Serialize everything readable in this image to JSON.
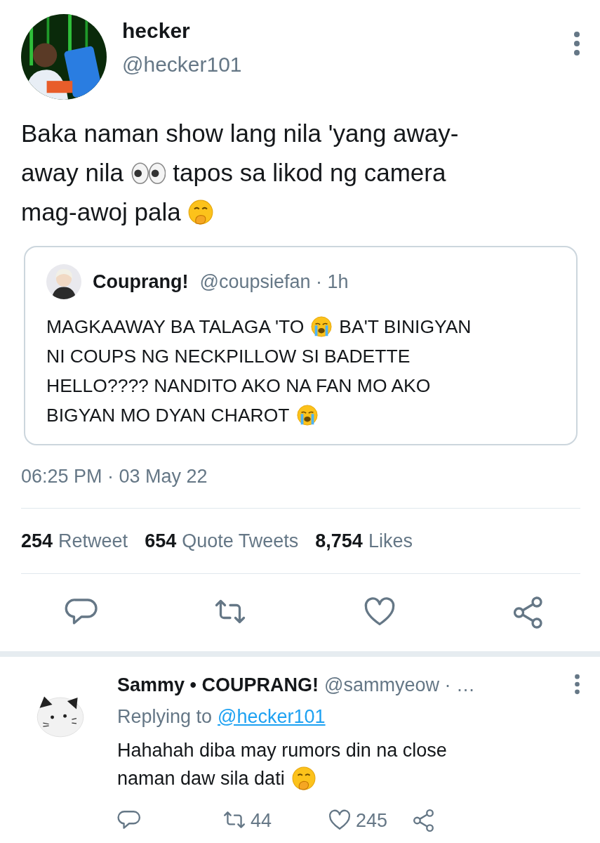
{
  "tweet": {
    "author": {
      "name": "hecker",
      "handle": "@hecker101",
      "avatar": {
        "kind": "picture"
      }
    },
    "body": [
      [
        {
          "kind": "text",
          "text": "Baka naman show lang nila 'yang away-"
        }
      ],
      [
        {
          "kind": "text",
          "text": "away nila"
        },
        {
          "kind": "eyes"
        },
        {
          "kind": "text",
          "text": "tapos sa likod ng camera"
        }
      ],
      [
        {
          "kind": "text",
          "text": "mag-awoj pala"
        },
        {
          "kind": "giggle"
        }
      ]
    ],
    "quote": {
      "name": "Couprang!",
      "meta": "@coupsiefan · 1h",
      "avatar": {
        "kind": "picture"
      },
      "body": [
        [
          {
            "kind": "text",
            "text": "MAGKAAWAY BA TALAGA 'TO"
          },
          {
            "kind": "crying"
          },
          {
            "kind": "text",
            "text": "BA'T BINIGYAN"
          }
        ],
        [
          {
            "kind": "text",
            "text": "NI COUPS NG NECKPILLOW SI BADETTE"
          }
        ],
        [
          {
            "kind": "text",
            "text": "HELLO???? NANDITO AKO NA FAN MO AKO"
          }
        ],
        [
          {
            "kind": "text",
            "text": "BIGYAN MO DYAN CHAROT"
          },
          {
            "kind": "crying"
          }
        ]
      ]
    },
    "timestamp": "06:25 PM · 03 May 22",
    "stats": [
      {
        "count": "254",
        "label": "Retweet"
      },
      {
        "count": "654",
        "label": "Quote Tweets"
      },
      {
        "count": "8,754",
        "label": "Likes"
      }
    ],
    "actions": [
      {
        "kind": "reply"
      },
      {
        "kind": "retweet"
      },
      {
        "kind": "like"
      },
      {
        "kind": "share"
      }
    ]
  },
  "reply": {
    "name": "Sammy • COUPRANG!",
    "handle": "@sammyeow · …",
    "avatar": {
      "kind": "picture"
    },
    "replying_label": "Replying to",
    "replying_to": "@hecker101",
    "body": [
      [
        {
          "kind": "text",
          "text": "Hahahah diba may rumors din na close"
        }
      ],
      [
        {
          "kind": "text",
          "text": "naman daw sila dati"
        },
        {
          "kind": "giggle"
        }
      ]
    ],
    "actions": [
      {
        "kind": "reply"
      },
      {
        "kind": "retweet",
        "count": "44"
      },
      {
        "kind": "like",
        "count": "245"
      },
      {
        "kind": "share"
      }
    ]
  }
}
